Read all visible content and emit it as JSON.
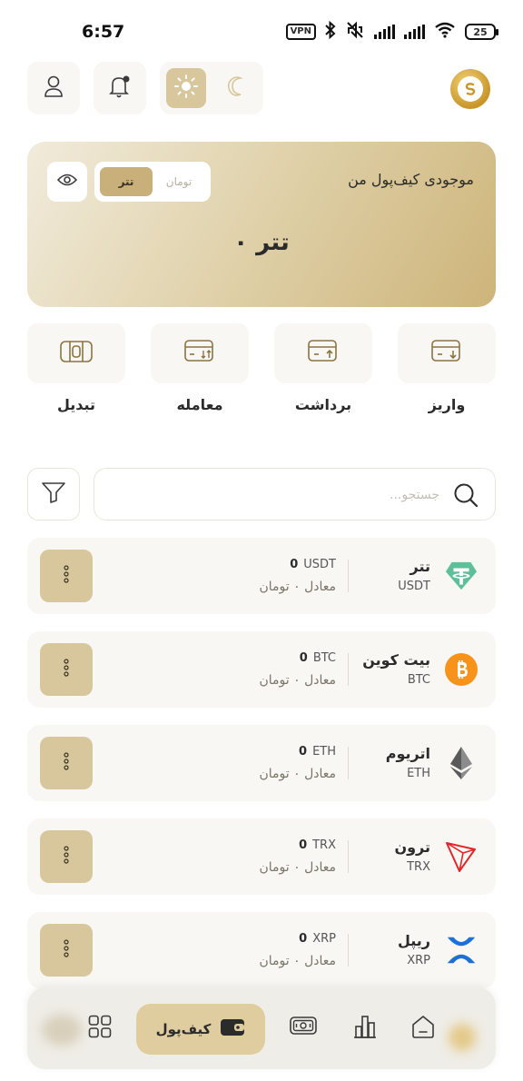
{
  "status_bar": {
    "time": "6:57",
    "vpn": "VPN",
    "battery": "25"
  },
  "header": {
    "icons": [
      "user-icon",
      "bell-icon",
      "sun-icon",
      "moon-icon",
      "app-logo"
    ]
  },
  "balance_card": {
    "title": "موجودی کیف‌پول من",
    "currency_options": [
      "تتر",
      "تومان"
    ],
    "selected_currency": "تتر",
    "amount": "۰ تتر"
  },
  "actions": [
    {
      "label": "واریز",
      "icon": "deposit-icon"
    },
    {
      "label": "برداشت",
      "icon": "withdraw-icon"
    },
    {
      "label": "معامله",
      "icon": "trade-icon"
    },
    {
      "label": "تبدیل",
      "icon": "convert-icon"
    }
  ],
  "search": {
    "placeholder": "جستجو..."
  },
  "assets": [
    {
      "name": "تتر",
      "symbol": "USDT",
      "quantity": "0",
      "unit": "USDT",
      "equivalent": "معادل ۰ تومان",
      "icon": "tether-icon"
    },
    {
      "name": "بیت کوین",
      "symbol": "BTC",
      "quantity": "0",
      "unit": "BTC",
      "equivalent": "معادل ۰ تومان",
      "icon": "bitcoin-icon"
    },
    {
      "name": "اتریوم",
      "symbol": "ETH",
      "quantity": "0",
      "unit": "ETH",
      "equivalent": "معادل ۰ تومان",
      "icon": "ethereum-icon"
    },
    {
      "name": "ترون",
      "symbol": "TRX",
      "quantity": "0",
      "unit": "TRX",
      "equivalent": "معادل ۰ تومان",
      "icon": "tron-icon"
    },
    {
      "name": "ریپل",
      "symbol": "XRP",
      "quantity": "0",
      "unit": "XRP",
      "equivalent": "معادل ۰ تومان",
      "icon": "ripple-icon"
    }
  ],
  "bottom_nav": {
    "active_label": "کیف‌پول",
    "items": [
      "grid-icon",
      "wallet-icon",
      "cash-icon",
      "chart-icon",
      "home-icon"
    ]
  },
  "colors": {
    "accent": "#c9b07a",
    "tile": "#f8f7f3",
    "more_button": "#d8c79c"
  }
}
